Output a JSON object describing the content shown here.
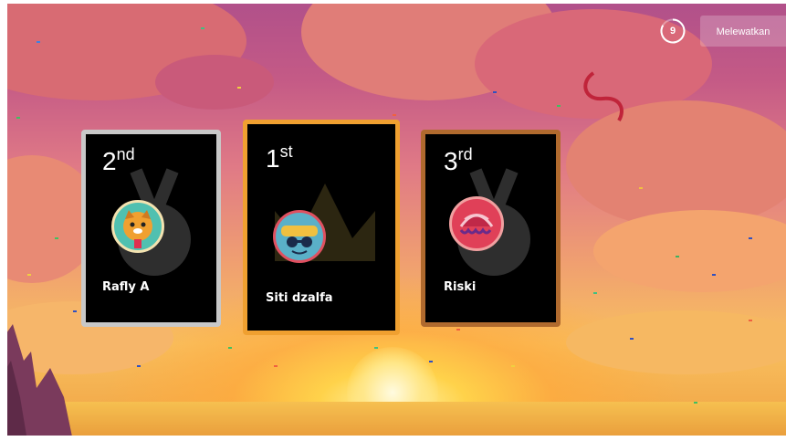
{
  "timer": {
    "value": "9"
  },
  "skip_button": {
    "label": "Melewatkan"
  },
  "podium": [
    {
      "rank": "2",
      "suffix": "nd",
      "name": "Rafly A",
      "border": "#c8c8c8",
      "avatar": "dog-avatar-icon"
    },
    {
      "rank": "1",
      "suffix": "st",
      "name": "Siti dzalfa",
      "border": "#f0a030",
      "avatar": "sunglasses-avatar-icon"
    },
    {
      "rank": "3",
      "suffix": "rd",
      "name": "Riski",
      "border": "#b06a2e",
      "avatar": "octopus-avatar-icon"
    }
  ],
  "colors": {
    "sky_top": "#b0508a",
    "sun": "#fff3a8",
    "card_bg": "#000000"
  }
}
